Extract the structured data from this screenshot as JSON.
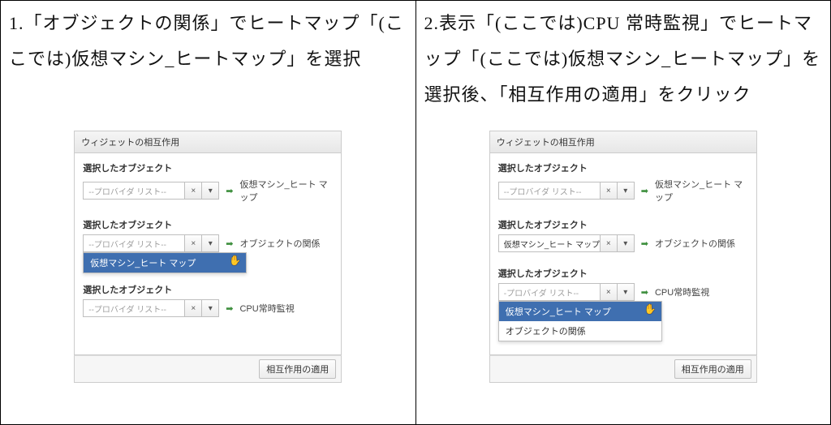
{
  "left": {
    "instruction": "1.「オブジェクトの関係」でヒートマップ「(ここでは)仮想マシン_ヒートマップ」を選択",
    "dialog": {
      "title": "ウィジェットの相互作用",
      "groups": [
        {
          "label": "選択したオブジェクト",
          "value": "--プロバイダ リスト--",
          "filled": false,
          "right": "仮想マシン_ヒート マップ"
        },
        {
          "label": "選択したオブジェクト",
          "value": "--プロバイダ リスト--",
          "filled": false,
          "right": "オブジェクトの関係",
          "dropdown": {
            "options": [
              {
                "text": "仮想マシン_ヒート マップ",
                "selected": true
              }
            ]
          }
        },
        {
          "label": "選択したオブジェクト",
          "value": "--プロバイダ リスト--",
          "filled": false,
          "right": "CPU常時監視"
        }
      ],
      "apply": "相互作用の適用"
    }
  },
  "right": {
    "instruction": "2.表示「(ここでは)CPU 常時監視」でヒートマップ「(ここでは)仮想マシン_ヒートマップ」を選択後、「相互作用の適用」をクリック",
    "dialog": {
      "title": "ウィジェットの相互作用",
      "groups": [
        {
          "label": "選択したオブジェクト",
          "value": "--プロバイダ リスト--",
          "filled": false,
          "right": "仮想マシン_ヒート マップ"
        },
        {
          "label": "選択したオブジェクト",
          "value": "仮想マシン_ヒート マップ",
          "filled": true,
          "right": "オブジェクトの関係"
        },
        {
          "label": "選択したオブジェクト",
          "value": "-プロバイダ リスト--",
          "filled": false,
          "right": "CPU常時監視",
          "dropdown": {
            "options": [
              {
                "text": "仮想マシン_ヒート マップ",
                "selected": true
              },
              {
                "text": "オブジェクトの関係",
                "selected": false
              }
            ]
          }
        }
      ],
      "apply": "相互作用の適用"
    }
  },
  "icons": {
    "clear": "×",
    "drop": "▾",
    "arrow": "➡",
    "cursor": "✋"
  }
}
